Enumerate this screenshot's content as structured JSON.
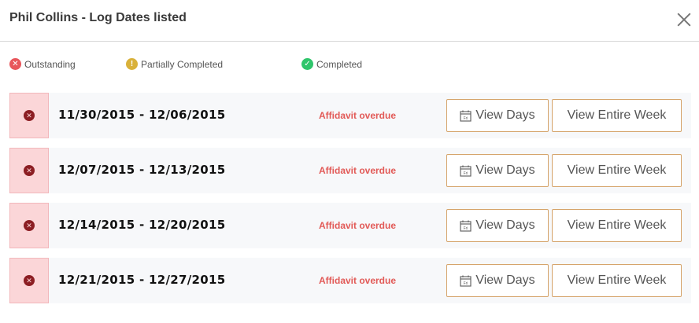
{
  "header": {
    "title": "Phil Collins - Log Dates listed"
  },
  "legend": [
    {
      "label": "Outstanding",
      "icon": "x-circle-icon",
      "color": "#e8565b"
    },
    {
      "label": "Partially Completed",
      "icon": "exclamation-circle-icon",
      "color": "#d9b13a"
    },
    {
      "label": "Completed",
      "icon": "check-circle-icon",
      "color": "#2fc56b"
    }
  ],
  "rows": [
    {
      "range": "11/30/2015 - 12/06/2015",
      "status": "Affidavit overdue",
      "view_days": "View Days",
      "view_week": "View Entire Week"
    },
    {
      "range": "12/07/2015 - 12/13/2015",
      "status": "Affidavit overdue",
      "view_days": "View Days",
      "view_week": "View Entire Week"
    },
    {
      "range": "12/14/2015 - 12/20/2015",
      "status": "Affidavit overdue",
      "view_days": "View Days",
      "view_week": "View Entire Week"
    },
    {
      "range": "12/21/2015 - 12/27/2015",
      "status": "Affidavit overdue",
      "view_days": "View Days",
      "view_week": "View Entire Week"
    }
  ]
}
